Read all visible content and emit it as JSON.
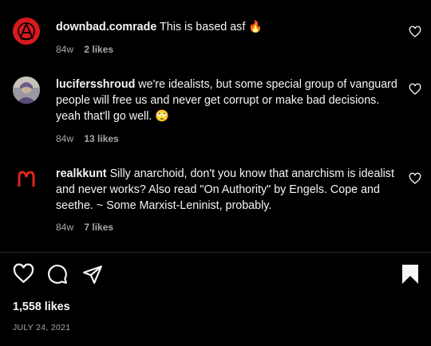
{
  "comments": [
    {
      "username": "downbad.comrade",
      "text": "This is based asf",
      "emoji": "🔥",
      "time": "84w",
      "likes": "2 likes",
      "avatar_icon": "anarchy-logo-avatar",
      "avatar_color": "#d71920"
    },
    {
      "username": "lucifersshroud",
      "text": "we're idealists, but some special group of vanguard people will free us and never get corrupt or make bad decisions. yeah that'll go well.",
      "emoji": "🙄",
      "time": "84w",
      "likes": "13 likes",
      "avatar_icon": "person-avatar"
    },
    {
      "username": "realkkunt",
      "text": "Silly anarchoid, don't you know that anarchism is idealist and never works? Also read \"On Authority\" by Engels. Cope and seethe. ~ Some Marxist-Leninist, probably.",
      "time": "84w",
      "likes": "7 likes",
      "avatar_icon": "mcdonalds-logo-avatar",
      "avatar_color": "#e1251b"
    }
  ],
  "actions": {
    "like_icon": "heart-icon",
    "comment_icon": "comment-icon",
    "share_icon": "share-icon",
    "save_icon": "bookmark-icon"
  },
  "post": {
    "likes_total": "1,558 likes",
    "date": "JULY 24, 2021"
  }
}
